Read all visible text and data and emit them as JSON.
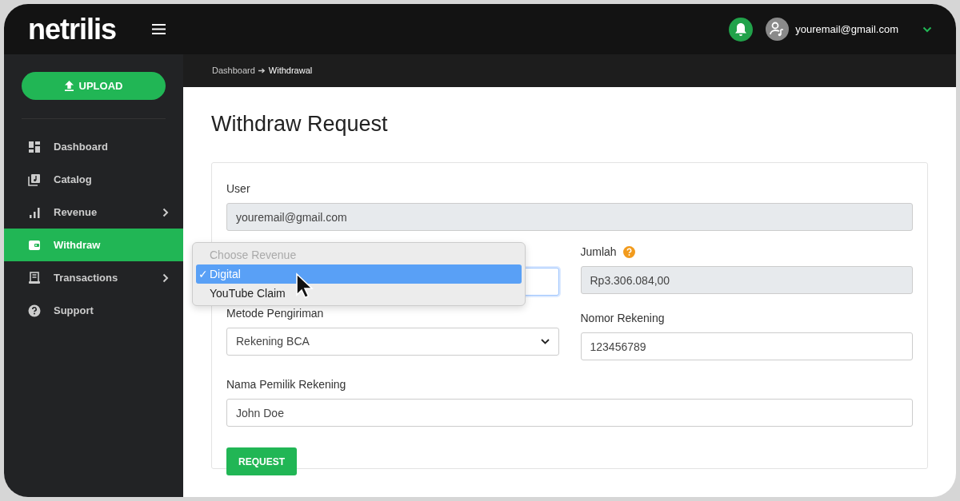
{
  "topbar": {
    "logo": "netrilis",
    "email": "youremail@gmail.com"
  },
  "sidebar": {
    "upload": "UPLOAD",
    "items": [
      {
        "label": "Dashboard",
        "selected": false,
        "has_submenu": false
      },
      {
        "label": "Catalog",
        "selected": false,
        "has_submenu": false
      },
      {
        "label": "Revenue",
        "selected": false,
        "has_submenu": true
      },
      {
        "label": "Withdraw",
        "selected": true,
        "has_submenu": false
      },
      {
        "label": "Transactions",
        "selected": false,
        "has_submenu": true
      },
      {
        "label": "Support",
        "selected": false,
        "has_submenu": false
      }
    ]
  },
  "breadcrumb": [
    "Dashboard",
    "Withdrawal"
  ],
  "page": {
    "title": "Withdraw Request"
  },
  "form": {
    "user": {
      "label": "User",
      "value": "youremail@gmail.com"
    },
    "jumlah": {
      "label": "Jumlah",
      "value": "Rp3.306.084,00"
    },
    "metode": {
      "label": "Metode Pengiriman",
      "value": "Rekening BCA"
    },
    "nomor": {
      "label": "Nomor Rekening",
      "value": "123456789"
    },
    "nama": {
      "label": "Nama Pemilik Rekening",
      "value": "John Doe"
    },
    "submit": "REQUEST"
  },
  "revenue_menu": {
    "check_mark": "✓",
    "options": [
      {
        "label": "Choose Revenue",
        "disabled": true,
        "selected": false
      },
      {
        "label": "Digital",
        "disabled": false,
        "selected": true
      },
      {
        "label": "YouTube Claim",
        "disabled": false,
        "selected": false
      }
    ]
  }
}
